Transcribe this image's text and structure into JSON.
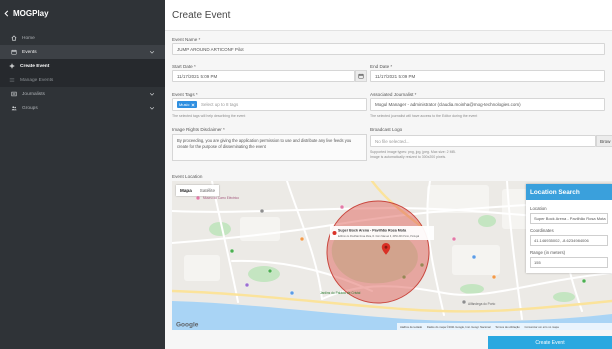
{
  "app": {
    "title": "MOGPlay",
    "back_icon": "chevron-left-icon"
  },
  "sidebar": {
    "items": [
      {
        "label": "Home",
        "icon": "home-icon"
      },
      {
        "label": "Events",
        "icon": "calendar-icon",
        "expandable": true,
        "expanded": true
      },
      {
        "label": "Create Event",
        "icon": "plus-icon",
        "active": true
      },
      {
        "label": "Manage Events",
        "icon": "list-icon"
      },
      {
        "label": "Journalists",
        "icon": "newspaper-icon",
        "expandable": true
      },
      {
        "label": "Groups",
        "icon": "users-icon",
        "expandable": true
      }
    ]
  },
  "page": {
    "title": "Create Event"
  },
  "form": {
    "event_name": {
      "label": "Event Name *",
      "value": "JUMP AROUND ARTICONF Pilot"
    },
    "start_date": {
      "label": "Start Date *",
      "value": "11/17/2021 5:09 PM",
      "icon": "calendar-icon"
    },
    "end_date": {
      "label": "End Date *",
      "value": "11/17/2021 5:09 PM"
    },
    "event_tags": {
      "label": "Event Tags *",
      "tags": [
        "Music"
      ],
      "placeholder": "Select up to 8 tags",
      "help": "The selected tags will help describing the event"
    },
    "journalist": {
      "label": "Associated Journalist *",
      "value": "Mogul Manager - administrator (claudia.moinha@mog-technologies.com)",
      "help": "The selected journalist will have access to the Editor during the event"
    },
    "disclaimer": {
      "label": "Image Rights Disclaimer *",
      "value": "By proceeding, you are giving the application permission to use and distribute any live feeds you create for the purpose of disseminating the event"
    },
    "broadcast_logo": {
      "label": "Broadcast Logo",
      "value": "No file selected...",
      "browse_label": "Brow",
      "help": [
        "Supported image types: png, jpg, jpeg. Max size: 2 MB.",
        "Image is automatically resized to 300x200 pixels."
      ]
    },
    "event_location": {
      "label": "Event Location"
    }
  },
  "map": {
    "type_options": [
      "Mapa",
      "Satélite"
    ],
    "selected_index": 0,
    "place": {
      "title": "Super Bock Arena - Pavilhão Rosa Mota",
      "address": "Edifício do Pavilhão Rosa Mota, R. Dom Manuel II, 4050-346 Porto, Portugal"
    },
    "labels": [
      "Museu do Carro Eléctrico",
      "Jardins do Palácio de Cristal",
      "Alfândega do Porto"
    ],
    "logo": "Google",
    "attribution": [
      "Atalhos de teclado",
      "Dados do mapa ©2021 Google, Inst. Geogr. Nacional",
      "Termos de utilização",
      "Comunicar um erro no mapa"
    ]
  },
  "location_search": {
    "title": "Location Search",
    "location_label": "Location",
    "location_value": "Super Bock Arena - Pavilhão Rosa Mota",
    "coordinates_label": "Coordinates",
    "coordinates_value": "41.146935002, -8.6234984006",
    "range_label": "Range (in meters)",
    "range_value": "155"
  },
  "actions": {
    "create_label": "Create Event"
  },
  "colors": {
    "sidebar_bg": "#2f3337",
    "accent": "#2ba8e0",
    "tag": "#2f8fe0",
    "panel_header": "#3aa0dc",
    "range_circle": "#e0625a"
  }
}
